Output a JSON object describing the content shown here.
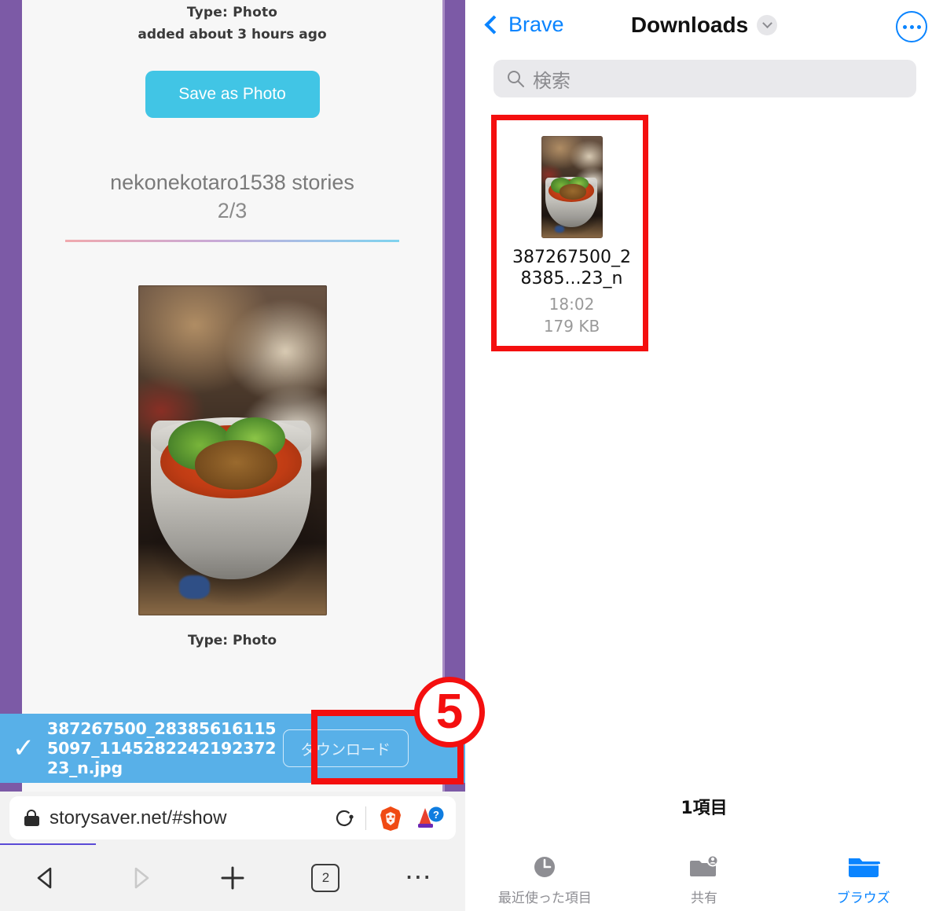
{
  "left_phone": {
    "storysaver": {
      "type_label_top": "Type: Photo",
      "added_label": "added about 3 hours ago",
      "save_button": "Save as Photo",
      "story_title": "nekonekotaro1538 stories",
      "story_counter": "2/3",
      "type_label_bottom": "Type: Photo"
    },
    "download_toast": {
      "check_icon": "check-icon",
      "file_name": "387267500_283856161155097_114528224219237223_n.jpg",
      "download_button": "ダウンロード"
    },
    "url_bar": {
      "lock_icon": "lock-icon",
      "url": "storysaver.net/#show",
      "reload_icon": "reload-icon",
      "brave_icon": "brave-lion-icon",
      "extension_icon": "extension-help-icon"
    },
    "toolbar": {
      "back_icon": "back-triangle-icon",
      "forward_icon": "forward-triangle-icon",
      "new_tab_icon": "plus-icon",
      "tab_count": "2",
      "menu_icon": "three-dots-icon"
    }
  },
  "right_phone": {
    "nav": {
      "back_label": "Brave",
      "back_icon": "chevron-left-icon",
      "title": "Downloads",
      "title_chevron_icon": "chevron-down-icon",
      "more_icon": "ellipsis-circle-icon"
    },
    "search": {
      "icon": "search-icon",
      "placeholder": "検索"
    },
    "file_item": {
      "thumbnail": "photo-thumbnail",
      "name_line1": "387267500_2",
      "name_line2": "8385...23_n",
      "time": "18:02",
      "size": "179 KB"
    },
    "item_count": "1項目",
    "tabs": [
      {
        "label": "最近使った項目",
        "icon": "clock-icon",
        "active": false
      },
      {
        "label": "共有",
        "icon": "shared-folder-icon",
        "active": false
      },
      {
        "label": "ブラウズ",
        "icon": "folder-icon",
        "active": true
      }
    ]
  },
  "annotations": {
    "step_number": "5",
    "highlight_color": "#f40f0f"
  },
  "colors": {
    "brave_purple_frame": "#7c5aa6",
    "save_button_blue": "#41c5e5",
    "toast_blue": "#58b0e8",
    "ios_blue": "#0a84ff",
    "annotation_red": "#f40f0f"
  }
}
